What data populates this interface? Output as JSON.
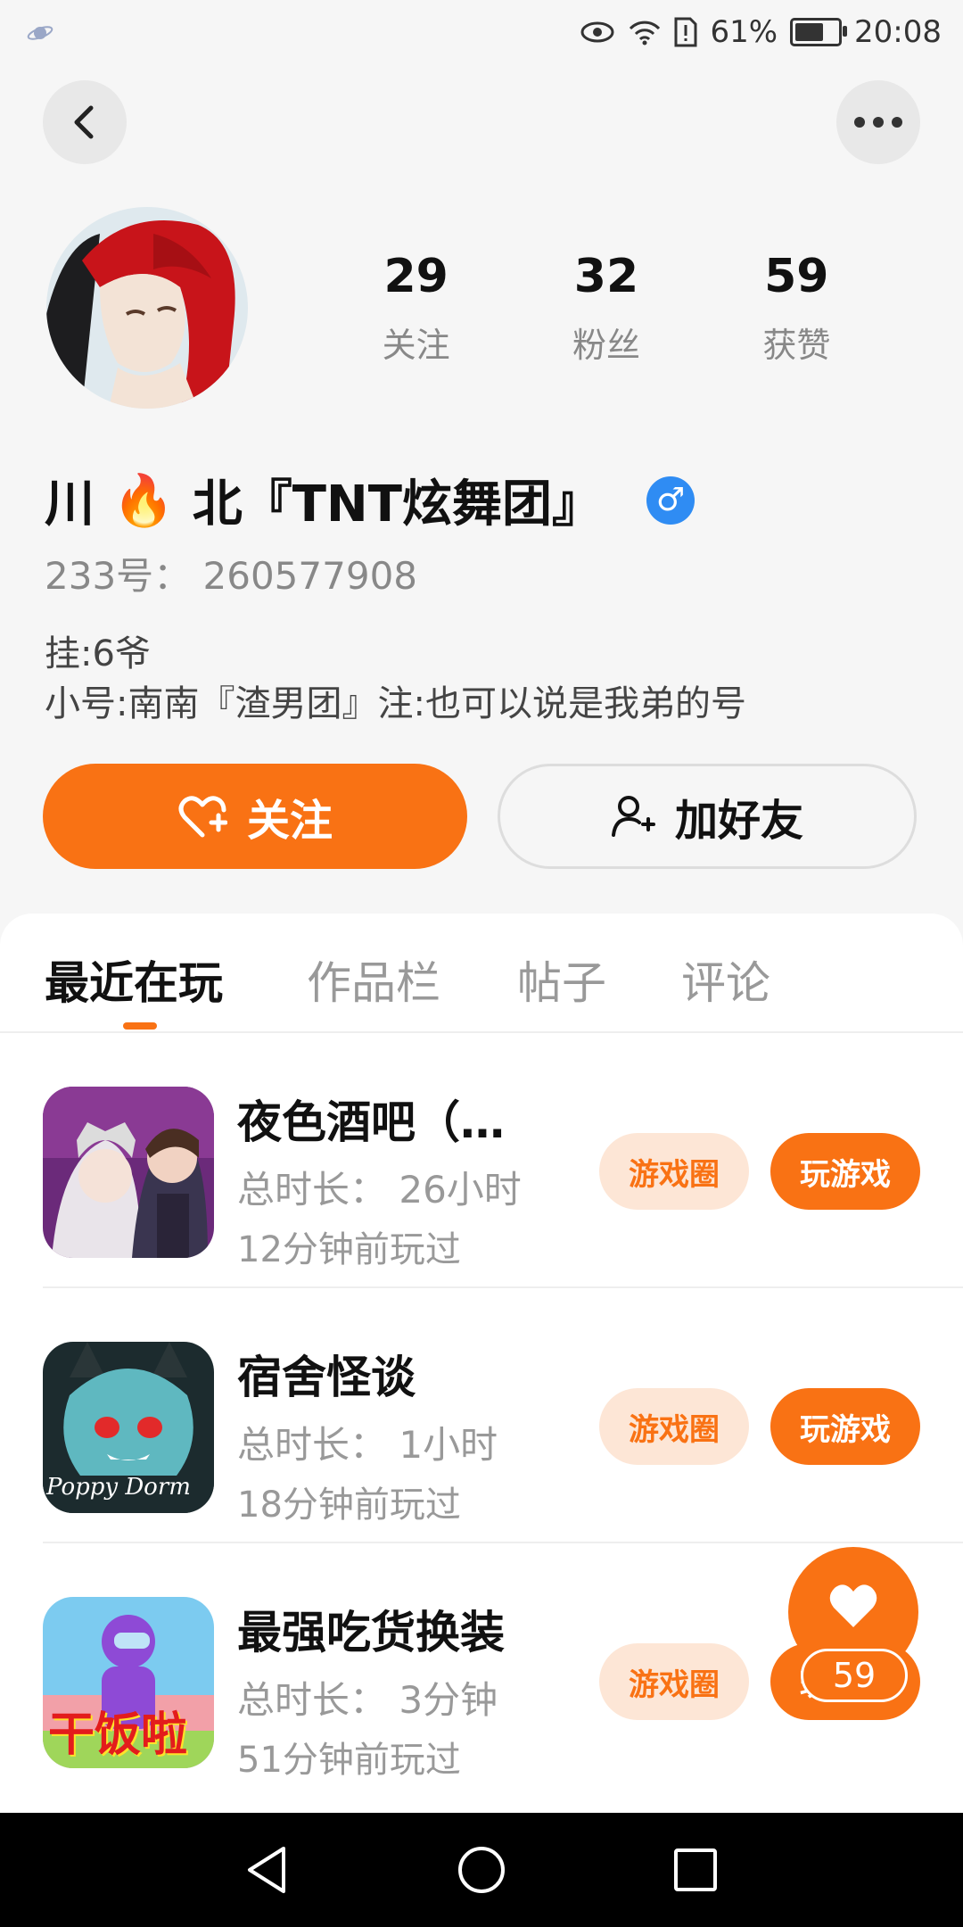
{
  "status_bar": {
    "battery": "61%",
    "time": "20:08"
  },
  "profile": {
    "stats": [
      {
        "value": "29",
        "label": "关注"
      },
      {
        "value": "32",
        "label": "粉丝"
      },
      {
        "value": "59",
        "label": "获赞"
      }
    ],
    "nickname_part1": "川",
    "nickname_emoji": "🔥",
    "nickname_part2": "北『TNT炫舞团』",
    "gender": "♂",
    "uid": "233号： 260577908",
    "bio_line1": "挂:6爷",
    "bio_line2": "小号:南南『渣男团』注:也可以说是我弟的号",
    "follow_label": "关注",
    "add_friend_label": "加好友"
  },
  "tabs": [
    "最近在玩",
    "作品栏",
    "帖子",
    "评论"
  ],
  "games": [
    {
      "title": "夜色酒吧（…",
      "duration": "总时长： 26小时",
      "last_played": "12分钟前玩过",
      "circle_label": "游戏圈",
      "play_label": "玩游戏"
    },
    {
      "title": "宿舍怪谈",
      "duration": "总时长： 1小时",
      "last_played": "18分钟前玩过",
      "circle_label": "游戏圈",
      "play_label": "玩游戏"
    },
    {
      "title": "最强吃货换装",
      "duration": "总时长： 3分钟",
      "last_played": "51分钟前玩过",
      "circle_label": "游戏圈",
      "play_label": "玩游戏"
    }
  ],
  "game_icon_texts": {
    "poppy": "Poppy Dorm",
    "food": "干饭啦"
  },
  "like_count": "59",
  "colors": {
    "accent": "#f97214",
    "accent_light": "#fde6d6",
    "gender_blue": "#2f8cf3"
  }
}
